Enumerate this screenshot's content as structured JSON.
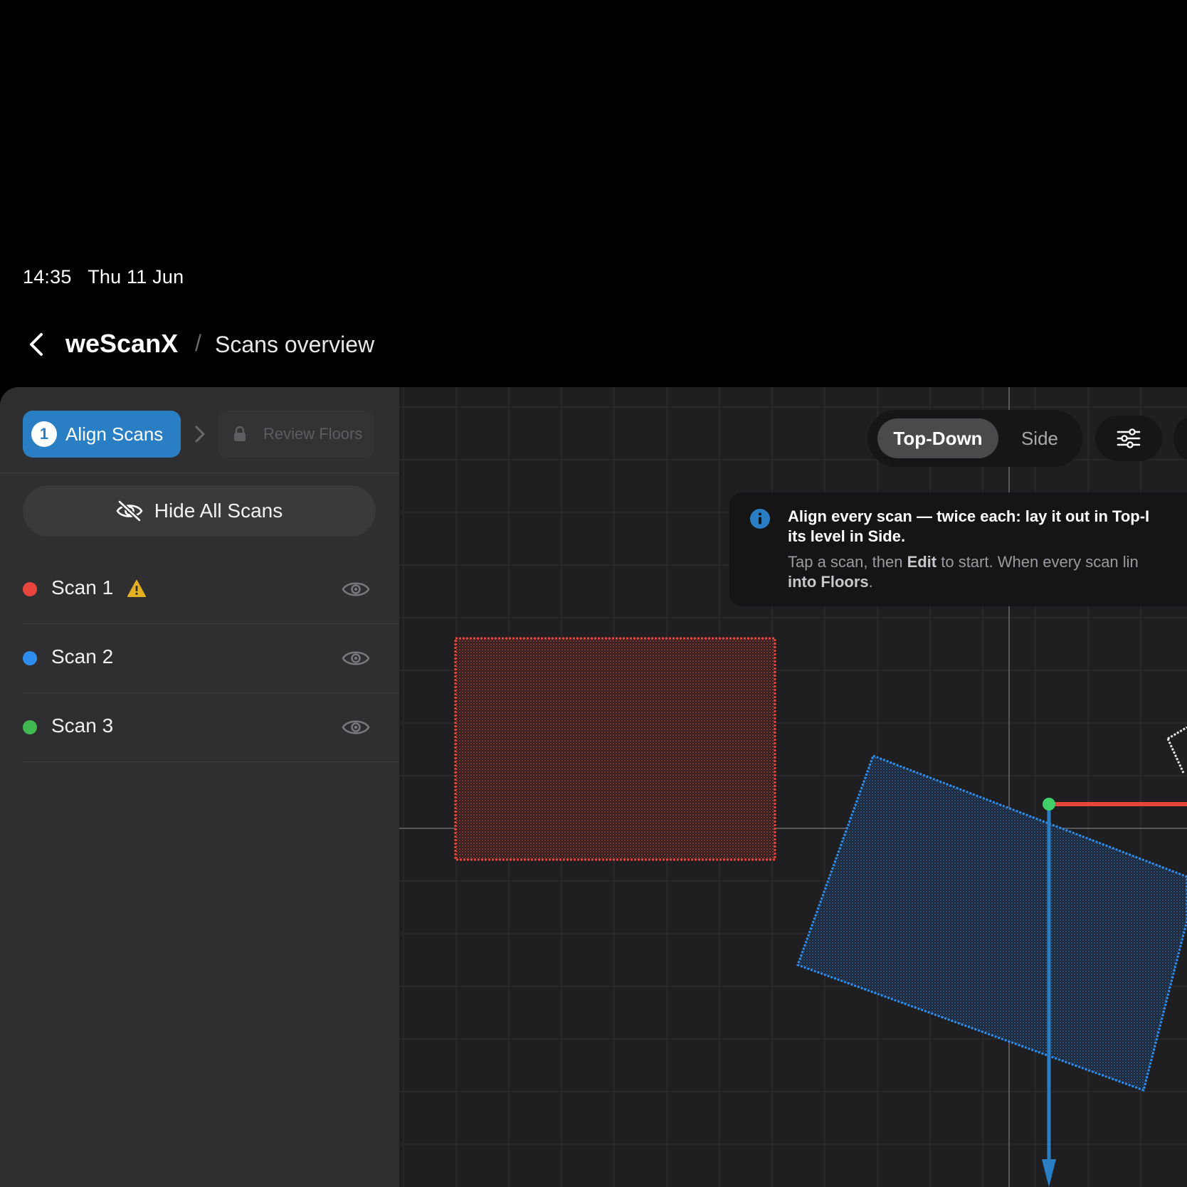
{
  "status_bar": {
    "time": "14:35",
    "date": "Thu 11 Jun"
  },
  "header": {
    "app_name": "weScanX",
    "separator": "/",
    "page": "Scans overview"
  },
  "steps": {
    "active": {
      "number": "1",
      "label": "Align Scans"
    },
    "locked": {
      "label": "Review Floors"
    }
  },
  "hide_all_label": "Hide All Scans",
  "scans": [
    {
      "name": "Scan 1",
      "color": "#e8453c",
      "warning": true
    },
    {
      "name": "Scan 2",
      "color": "#2e8ef0",
      "warning": false
    },
    {
      "name": "Scan 3",
      "color": "#3fb950",
      "warning": false
    }
  ],
  "view_toggle": {
    "active": "Top-Down",
    "inactive": "Side"
  },
  "info_card": {
    "title_line1": "Align every scan — twice each: lay it out in Top-I",
    "title_line2": "its level in Side.",
    "body_1": "Tap a scan, then ",
    "body_edit": "Edit",
    "body_2": " to start. When every scan lin",
    "body_floors": "into Floors",
    "body_end": "."
  },
  "colors": {
    "accent": "#2a7fc4",
    "scan1": "#e8453c",
    "scan2": "#2e8ef0",
    "scan3": "#3fb950",
    "warning": "#e3b021",
    "axis_x": "#e8453c",
    "axis_y": "#2a7fc4",
    "origin": "#3fd067"
  }
}
